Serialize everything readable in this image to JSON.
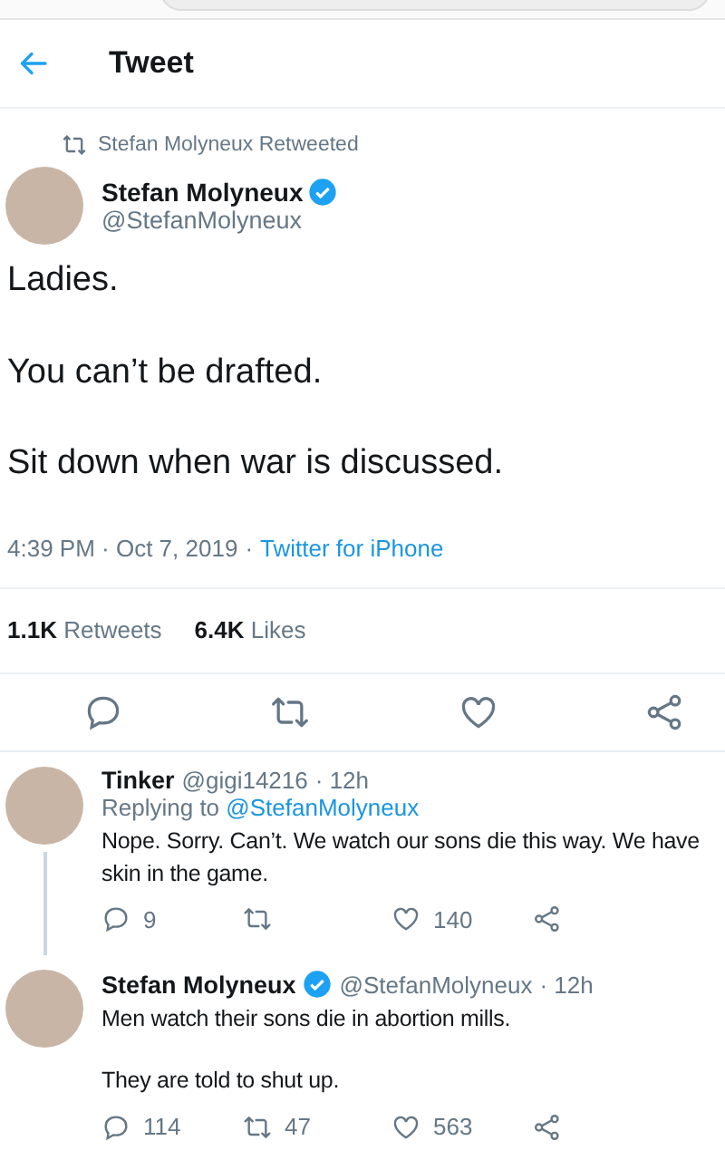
{
  "header": {
    "title": "Tweet"
  },
  "tweet": {
    "retweeted_by": "Stefan Molyneux Retweeted",
    "author": {
      "name": "Stefan Molyneux",
      "handle": "@StefanMolyneux",
      "verified": true
    },
    "paragraphs": [
      "Ladies.",
      "You can’t be drafted.",
      "Sit down when war is discussed."
    ],
    "time": "4:39 PM · Oct 7, 2019",
    "separator": "·",
    "source": "Twitter for iPhone",
    "stats": [
      {
        "count": "1.1K",
        "label": "Retweets"
      },
      {
        "count": "6.4K",
        "label": "Likes"
      }
    ]
  },
  "replies": [
    {
      "name": "Tinker",
      "verified": false,
      "handle": "@gigi14216",
      "time": "· 12h",
      "replying_prefix": "Replying to",
      "replying_to": "@StefanMolyneux",
      "thread_line": true,
      "paragraphs": [
        "Nope. Sorry. Can’t. We watch our sons die this way. We have skin in the game."
      ],
      "reply_count": "9",
      "like_count": "140"
    },
    {
      "name": "Stefan Molyneux",
      "verified": true,
      "handle": "@StefanMolyneux",
      "time": "· 12h",
      "thread_line": false,
      "paragraphs": [
        "Men watch their sons die in abortion mills.",
        "They are told to shut up."
      ],
      "reply_count": "114",
      "retweet_count": "47",
      "like_count": "563"
    }
  ]
}
